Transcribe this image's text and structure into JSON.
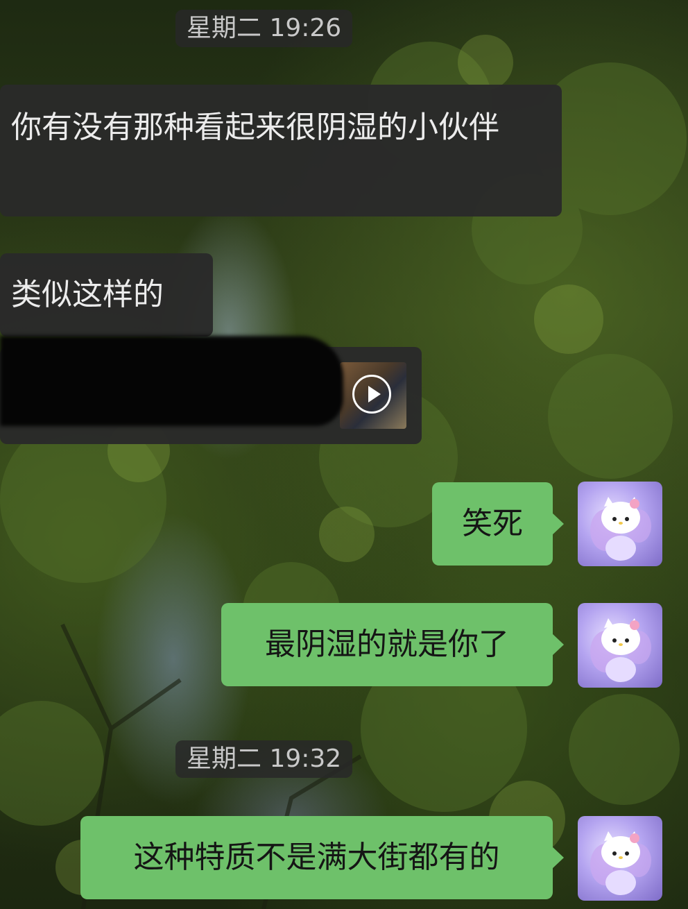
{
  "chat": {
    "timestamps": [
      "星期二 19:26",
      "星期二 19:32"
    ],
    "messages": [
      {
        "side": "incoming",
        "type": "text",
        "text": "你有没有那种看起来很阴湿的小伙伴"
      },
      {
        "side": "incoming",
        "type": "text",
        "text": "类似这样的"
      },
      {
        "side": "incoming",
        "type": "video",
        "text": ""
      },
      {
        "side": "outgoing",
        "type": "text",
        "text": "笑死"
      },
      {
        "side": "outgoing",
        "type": "text",
        "text": "最阴湿的就是你了"
      },
      {
        "side": "outgoing",
        "type": "text",
        "text": "这种特质不是满大街都有的"
      }
    ]
  },
  "icons": {
    "video_play": "play-icon",
    "avatar": "hello-kitty-fairy-avatar"
  },
  "colors": {
    "outgoing_bubble": "#6ec16a",
    "incoming_bubble": "#2a2a2a",
    "timestamp_bg": "#282828"
  }
}
